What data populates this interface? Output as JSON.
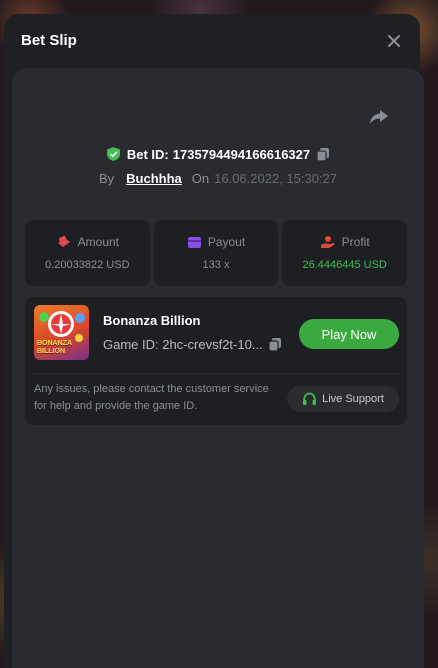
{
  "modal": {
    "title": "Bet Slip"
  },
  "bet": {
    "id_label": "Bet ID:",
    "id_value": "1735794494166616327",
    "by_label": "By",
    "user": "Buchhha",
    "on_label": "On",
    "date": "16.06.2022, 15:30:27"
  },
  "stats": [
    {
      "label": "Amount",
      "value": "0.20033822 USD",
      "icon": "coins-icon"
    },
    {
      "label": "Payout",
      "value": "133 x",
      "icon": "wallet-icon"
    },
    {
      "label": "Profit",
      "value": "26.4446445 USD",
      "icon": "hand-coin-icon"
    }
  ],
  "game": {
    "thumb_text": "BONANZA BILLION",
    "name": "Bonanza Billion",
    "id_text": "Game ID: 2hc-crevsf2t-10...",
    "play_label": "Play Now"
  },
  "support": {
    "text": "Any issues, please contact the customer service for help and provide the game ID.",
    "button_label": "Live Support"
  },
  "colors": {
    "accent_green": "#3aa940",
    "profit_green": "#3fbf4f",
    "amount_icon": "#e0455a",
    "payout_icon": "#8a4fe0",
    "profit_icon": "#e04a3a"
  }
}
